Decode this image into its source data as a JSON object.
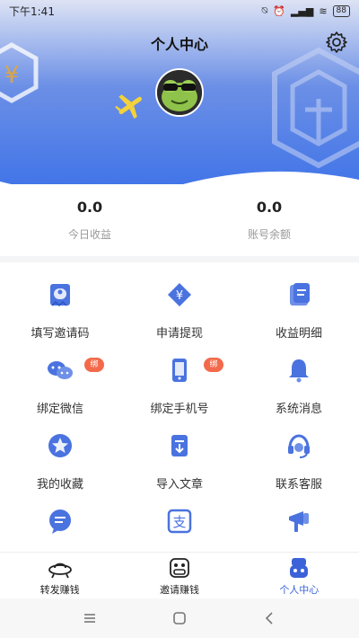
{
  "status_bar": {
    "time": "下午1:41",
    "battery": "88"
  },
  "header": {
    "title": "个人中心",
    "settings_icon": "gear-icon"
  },
  "stats": [
    {
      "value": "0.0",
      "label": "今日收益"
    },
    {
      "value": "0.0",
      "label": "账号余额"
    }
  ],
  "menu": [
    {
      "label": "填写邀请码",
      "icon": "invite-code-icon"
    },
    {
      "label": "申请提现",
      "icon": "withdraw-icon"
    },
    {
      "label": "收益明细",
      "icon": "income-detail-icon"
    },
    {
      "label": "绑定微信",
      "icon": "wechat-icon",
      "badge": "绑"
    },
    {
      "label": "绑定手机号",
      "icon": "phone-icon",
      "badge": "绑"
    },
    {
      "label": "系统消息",
      "icon": "bell-icon"
    },
    {
      "label": "我的收藏",
      "icon": "star-icon"
    },
    {
      "label": "导入文章",
      "icon": "import-article-icon"
    },
    {
      "label": "联系客服",
      "icon": "headset-icon"
    },
    {
      "label": "",
      "icon": "feedback-icon"
    },
    {
      "label": "",
      "icon": "alipay-icon"
    },
    {
      "label": "",
      "icon": "megaphone-icon"
    }
  ],
  "tabs": [
    {
      "label": "转发赚钱",
      "icon": "ufo-icon",
      "active": false
    },
    {
      "label": "邀请赚钱",
      "icon": "invite-icon",
      "active": false
    },
    {
      "label": "个人中心",
      "icon": "robot-icon",
      "active": true
    }
  ],
  "nav": [
    "menu-icon",
    "home-icon",
    "back-icon"
  ],
  "colors": {
    "accent": "#3f73e8",
    "icon_blue": "#4a73e0",
    "badge": "#f26a4b"
  }
}
